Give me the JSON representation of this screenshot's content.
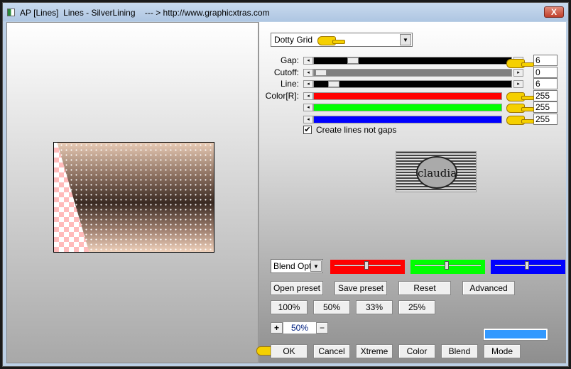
{
  "window": {
    "title": "AP [Lines]  Lines - SilverLining    --- > http://www.graphicxtras.com",
    "close_label": "X"
  },
  "mode_select": {
    "value": "Dotty Grid"
  },
  "sliders": [
    {
      "label": "Gap:",
      "value": "6",
      "color": "#000000"
    },
    {
      "label": "Cutoff:",
      "value": "0",
      "color": "#808080"
    },
    {
      "label": "Line:",
      "value": "6",
      "color": "#000000"
    },
    {
      "label": "Color[R]:",
      "value": "255",
      "color": "#ff0000"
    },
    {
      "label": "",
      "value": "255",
      "color": "#00ff00"
    },
    {
      "label": "",
      "value": "255",
      "color": "#0000ff"
    }
  ],
  "checkbox": {
    "label": "Create lines not gaps",
    "checked": true
  },
  "logo": {
    "text": "claudia"
  },
  "blend_select": {
    "value": "Blend Opti"
  },
  "color_sliders": [
    {
      "color": "#ff0000"
    },
    {
      "color": "#00ff00"
    },
    {
      "color": "#0000ff"
    }
  ],
  "buttons_row1": [
    "Open preset",
    "Save preset",
    "Reset",
    "Advanced"
  ],
  "zoom_buttons": [
    "100%",
    "50%",
    "33%",
    "25%"
  ],
  "zoom": {
    "plus": "+",
    "value": "50%",
    "minus": "−"
  },
  "color_swatch": "#3399ff",
  "buttons_bottom": [
    "OK",
    "Cancel",
    "Xtreme",
    "Color",
    "Blend",
    "Mode"
  ]
}
